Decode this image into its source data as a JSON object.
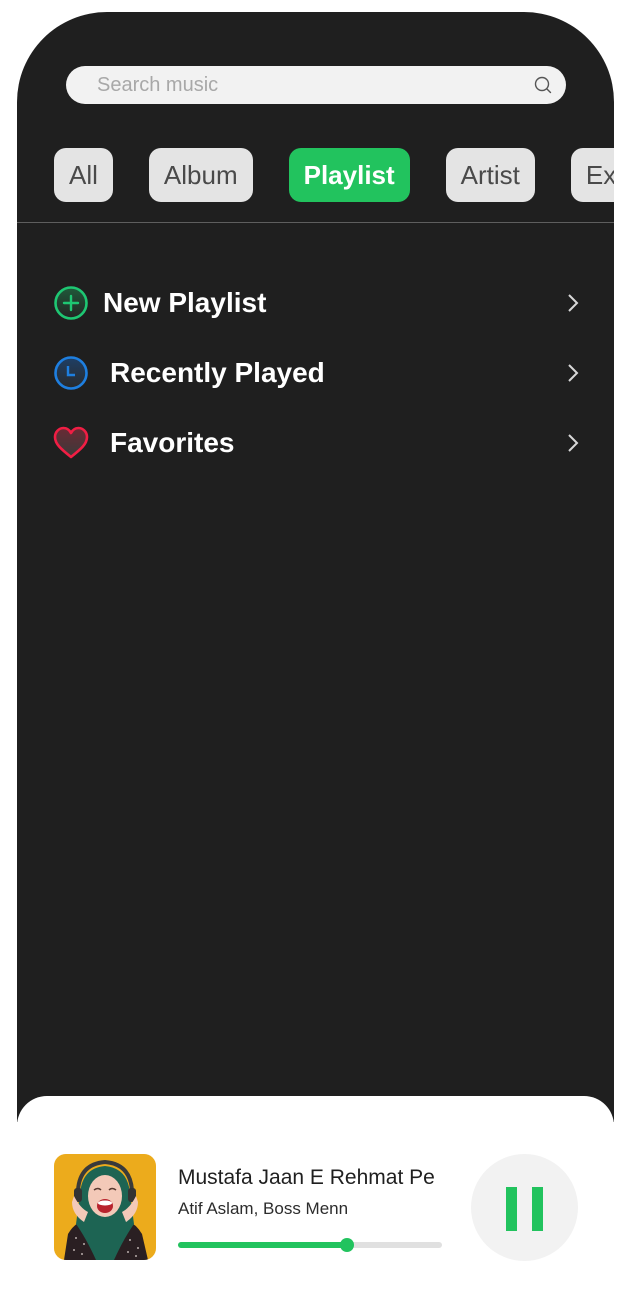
{
  "search": {
    "placeholder": "Search music",
    "value": "",
    "icon": "search-icon"
  },
  "filters": {
    "active_index": 2,
    "chips": [
      {
        "label": "All"
      },
      {
        "label": "Album"
      },
      {
        "label": "Playlist"
      },
      {
        "label": "Artist"
      },
      {
        "label": "Ex"
      }
    ]
  },
  "menu": {
    "items": [
      {
        "label": "New Playlist",
        "icon": "plus-circle-icon",
        "icon_color": "#1ec773"
      },
      {
        "label": "Recently Played",
        "icon": "clock-icon",
        "icon_color": "#1e7fe0"
      },
      {
        "label": "Favorites",
        "icon": "heart-icon",
        "icon_color": "#f01e44"
      }
    ]
  },
  "now_playing": {
    "title": "Mustafa Jaan E Rehmat Pe",
    "artist": "Atif Aslam, Boss Menn",
    "progress": 0.64,
    "state": "playing",
    "control_icon": "pause-icon"
  },
  "colors": {
    "accent": "#22c35e",
    "background": "#1f1f1f",
    "chip": "#e4e4e4"
  }
}
